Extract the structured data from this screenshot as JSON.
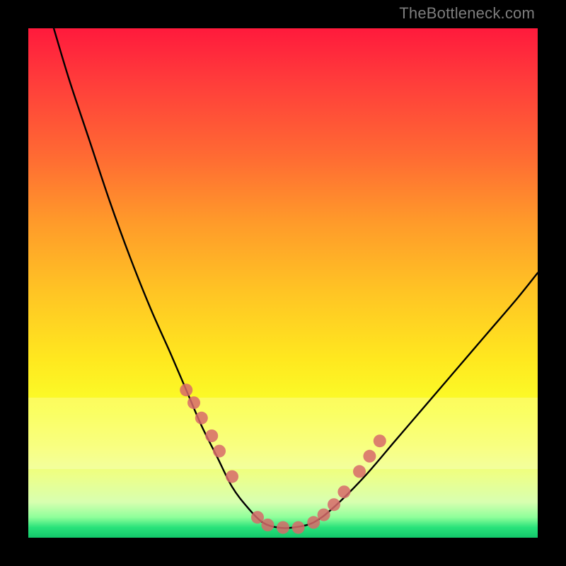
{
  "attribution": "TheBottleneck.com",
  "chart_data": {
    "type": "line",
    "title": "",
    "xlabel": "",
    "ylabel": "",
    "xlim": [
      0,
      100
    ],
    "ylim": [
      0,
      100
    ],
    "series": [
      {
        "name": "bottleneck-curve",
        "x": [
          5,
          8,
          12,
          16,
          20,
          24,
          28,
          31,
          34,
          37,
          40,
          43,
          46,
          49,
          52,
          56,
          60,
          66,
          72,
          78,
          84,
          90,
          96,
          100
        ],
        "y": [
          100,
          90,
          78,
          66,
          55,
          45,
          36,
          29,
          22,
          16,
          10,
          6,
          3,
          2,
          2,
          3,
          6,
          12,
          19,
          26,
          33,
          40,
          47,
          52
        ]
      }
    ],
    "markers": {
      "name": "highlight-dots",
      "color": "#d76a6a",
      "radius_px": 9,
      "x": [
        31,
        32.5,
        34,
        36,
        37.5,
        40,
        45,
        47,
        50,
        53,
        56,
        58,
        60,
        62,
        65,
        67,
        69
      ],
      "y": [
        29,
        26.5,
        23.5,
        20,
        17,
        12,
        4,
        2.5,
        2,
        2,
        3,
        4.5,
        6.5,
        9,
        13,
        16,
        19
      ]
    },
    "background_gradient": {
      "type": "vertical",
      "stops": [
        {
          "pos": 0.0,
          "color": "#ff1a3c"
        },
        {
          "pos": 0.25,
          "color": "#ff6a33"
        },
        {
          "pos": 0.52,
          "color": "#ffc524"
        },
        {
          "pos": 0.75,
          "color": "#faff2a"
        },
        {
          "pos": 0.93,
          "color": "#d8ffb0"
        },
        {
          "pos": 1.0,
          "color": "#13c86b"
        }
      ]
    }
  }
}
